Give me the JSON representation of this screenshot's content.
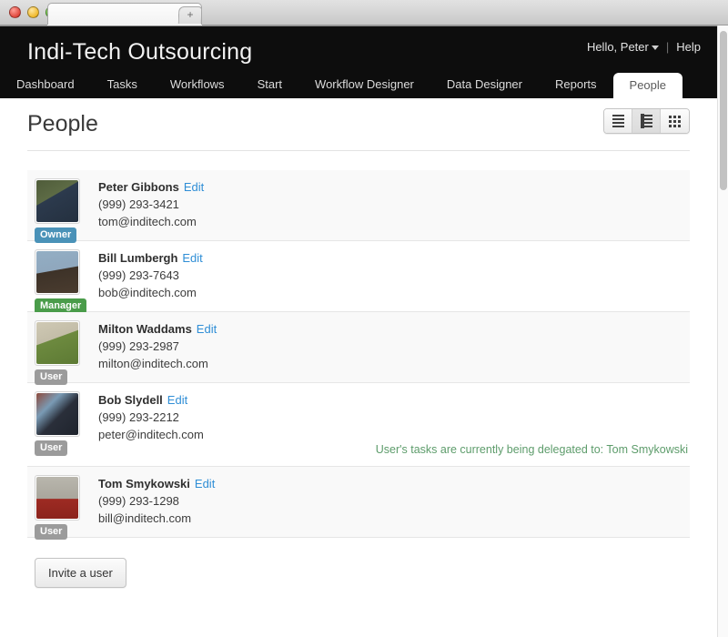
{
  "browser": {
    "tab_title": "",
    "close_icon": "×",
    "new_tab_icon": "+",
    "traffic_lights": [
      "close-red",
      "minimize-yellow",
      "zoom-green"
    ]
  },
  "app": {
    "brand": "Indi-Tech Outsourcing",
    "user_greeting": "Hello, Peter",
    "divider": "|",
    "help_label": "Help",
    "nav_tabs": [
      {
        "label": "Dashboard",
        "active": false
      },
      {
        "label": "Tasks",
        "active": false
      },
      {
        "label": "Workflows",
        "active": false
      },
      {
        "label": "Start",
        "active": false
      },
      {
        "label": "Workflow Designer",
        "active": false
      },
      {
        "label": "Data Designer",
        "active": false
      },
      {
        "label": "Reports",
        "active": false
      },
      {
        "label": "People",
        "active": true
      }
    ]
  },
  "page": {
    "title": "People",
    "view_modes": [
      {
        "name": "list-view",
        "icon": "rows-icon",
        "active": false
      },
      {
        "name": "detail-view",
        "icon": "rows-with-thumb-icon",
        "active": true
      },
      {
        "name": "grid-view",
        "icon": "grid-icon",
        "active": false
      }
    ],
    "edit_label": "Edit",
    "invite_button": "Invite a user",
    "people": [
      {
        "name": "Peter Gibbons",
        "phone": "(999) 293-3421",
        "email": "tom@inditech.com",
        "role": "Owner",
        "role_class": "owner",
        "avatar_colors": [
          "#4f5c3a",
          "#2c3a4d"
        ],
        "note": ""
      },
      {
        "name": "Bill Lumbergh",
        "phone": "(999) 293-7643",
        "email": "bob@inditech.com",
        "role": "Manager",
        "role_class": "manager",
        "avatar_colors": [
          "#8fa7bd",
          "#3d3228"
        ],
        "note": ""
      },
      {
        "name": "Milton Waddams",
        "phone": "(999) 293-2987",
        "email": "milton@inditech.com",
        "role": "User",
        "role_class": "user",
        "avatar_colors": [
          "#cfc9b4",
          "#6d8a3f"
        ],
        "note": ""
      },
      {
        "name": "Bob Slydell",
        "phone": "(999) 293-2212",
        "email": "peter@inditech.com",
        "role": "User",
        "role_class": "user",
        "avatar_colors": [
          "#8d4a3c",
          "#2a2f3a"
        ],
        "note": "User's tasks are currently being delegated to: Tom Smykowski"
      },
      {
        "name": "Tom Smykowski",
        "phone": "(999) 293-1298",
        "email": "bill@inditech.com",
        "role": "User",
        "role_class": "user",
        "avatar_colors": [
          "#b9b6ad",
          "#9e2b23"
        ],
        "note": ""
      }
    ]
  },
  "colors": {
    "appbar_bg": "#0d0d0d",
    "link_blue": "#2f8ed6",
    "badge_owner": "#4a92b8",
    "badge_manager": "#4a9c4a",
    "badge_user": "#9b9b9b",
    "note_green": "#5d9c6b"
  }
}
